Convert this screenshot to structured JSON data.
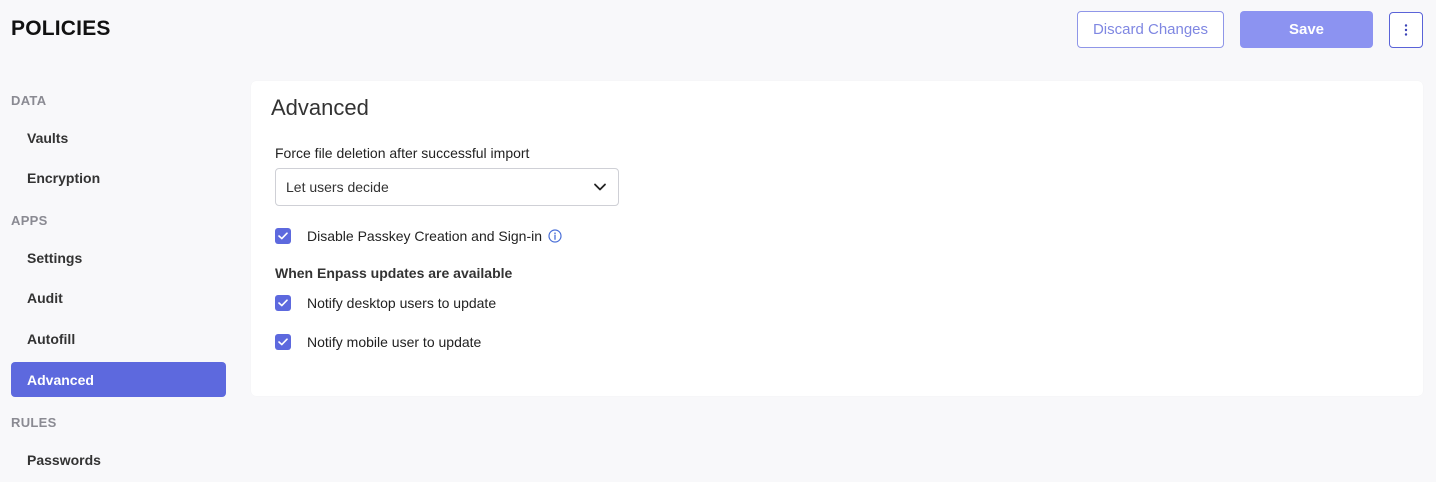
{
  "header": {
    "title": "POLICIES",
    "discard_label": "Discard Changes",
    "save_label": "Save",
    "more_icon": "vertical-dots-icon"
  },
  "sidebar": {
    "sections": [
      {
        "label": "DATA",
        "items": [
          {
            "label": "Vaults",
            "active": false
          },
          {
            "label": "Encryption",
            "active": false
          }
        ]
      },
      {
        "label": "APPS",
        "items": [
          {
            "label": "Settings",
            "active": false
          },
          {
            "label": "Audit",
            "active": false
          },
          {
            "label": "Autofill",
            "active": false
          },
          {
            "label": "Advanced",
            "active": true
          }
        ]
      },
      {
        "label": "RULES",
        "items": [
          {
            "label": "Passwords",
            "active": false
          }
        ]
      }
    ]
  },
  "main": {
    "title": "Advanced",
    "force_deletion": {
      "label": "Force file deletion after successful import",
      "selected": "Let users decide"
    },
    "passkey": {
      "label": "Disable Passkey Creation and Sign-in",
      "checked": true
    },
    "updates": {
      "heading": "When Enpass updates are available",
      "desktop_label": "Notify desktop users to update",
      "desktop_checked": true,
      "mobile_label": "Notify mobile user to update",
      "mobile_checked": true
    }
  },
  "colors": {
    "accent": "#5d69de",
    "save_button": "#8c93f1",
    "page_background": "#f8f8fa",
    "section_label": "#8a8a92"
  }
}
